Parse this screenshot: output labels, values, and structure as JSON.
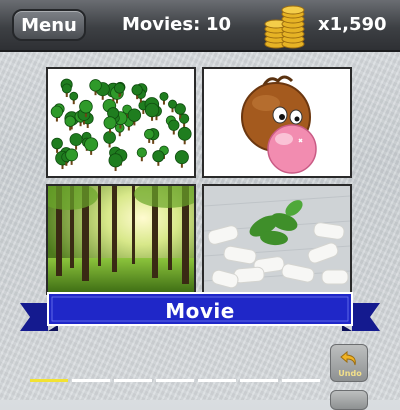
{
  "header": {
    "menu_label": "Menu",
    "movies_label": "Movies:",
    "movies_count": "10",
    "coins_value": "x1,590",
    "coins_icon": "coin-stack-icon"
  },
  "puzzle": {
    "tiles": [
      {
        "depicts": "many small trees"
      },
      {
        "depicts": "cartoon face blowing bubble gum"
      },
      {
        "depicts": "sunlit forest"
      },
      {
        "depicts": "chewing gum pieces with mint leaves"
      }
    ],
    "category_label": "Movie",
    "answer_slots_total": 7,
    "answer_slots_filled": 1
  },
  "controls": {
    "undo_label": "Undo",
    "undo_icon": "undo-arrow-icon"
  },
  "colors": {
    "ribbon_blue": "#1f27c8",
    "progress_filled": "#f2e233",
    "progress_empty": "#ffffff",
    "coin_gold": "#e6b325"
  }
}
